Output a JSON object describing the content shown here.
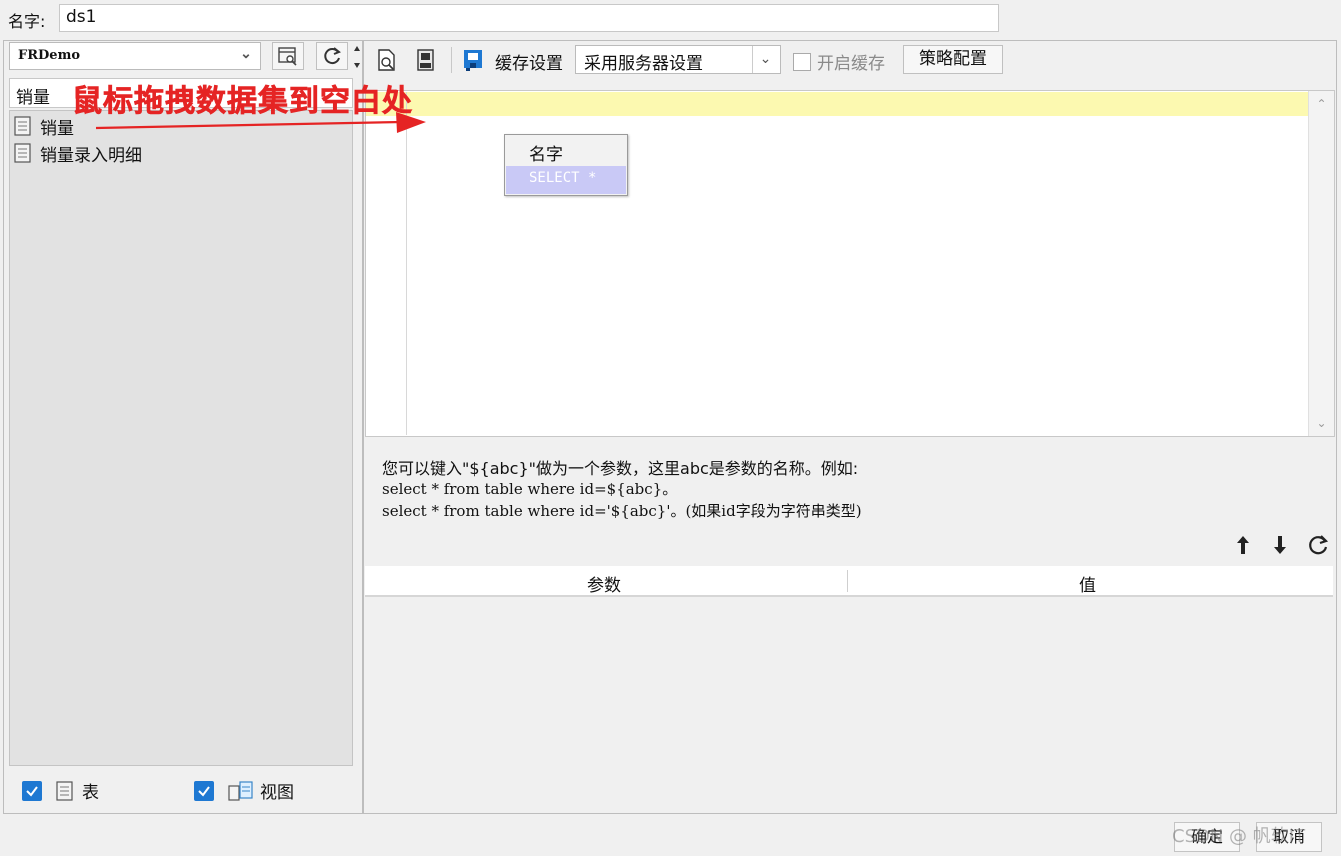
{
  "name_row": {
    "label": "名字:",
    "value": "ds1"
  },
  "left": {
    "database": "FRDemo",
    "search_value": "销量",
    "tree_items": [
      "销量",
      "销量录入明细"
    ],
    "filters": [
      {
        "label": "表",
        "checked": true
      },
      {
        "label": "视图",
        "checked": true
      }
    ]
  },
  "toolbar": {
    "cache_label": "缓存设置",
    "cache_option": "采用服务器设置",
    "enable_cache_label": "开启缓存",
    "strategy_button": "策略配置"
  },
  "editor": {
    "autocomplete_title": "名字",
    "autocomplete_item": "SELECT *"
  },
  "annotation": {
    "text": "鼠标拖拽数据集到空白处"
  },
  "hint": {
    "line1": "您可以键入\"${abc}\"做为一个参数，这里abc是参数的名称。例如:",
    "line2": "select * from table where id=${abc}。",
    "line3": "select * from table where id='${abc}'。(如果id字段为字符串类型)"
  },
  "params_table": {
    "columns": [
      "参数",
      "值"
    ],
    "rows": []
  },
  "bottom": {
    "ok": "确定",
    "cancel": "取消",
    "watermark": "CSDN @ 帆软IT"
  },
  "colors": {
    "accent": "#1e78d2",
    "annotation": "#e52424",
    "highlight_line": "#fcf9b0",
    "autocomplete_selected": "#c9c9f6"
  }
}
